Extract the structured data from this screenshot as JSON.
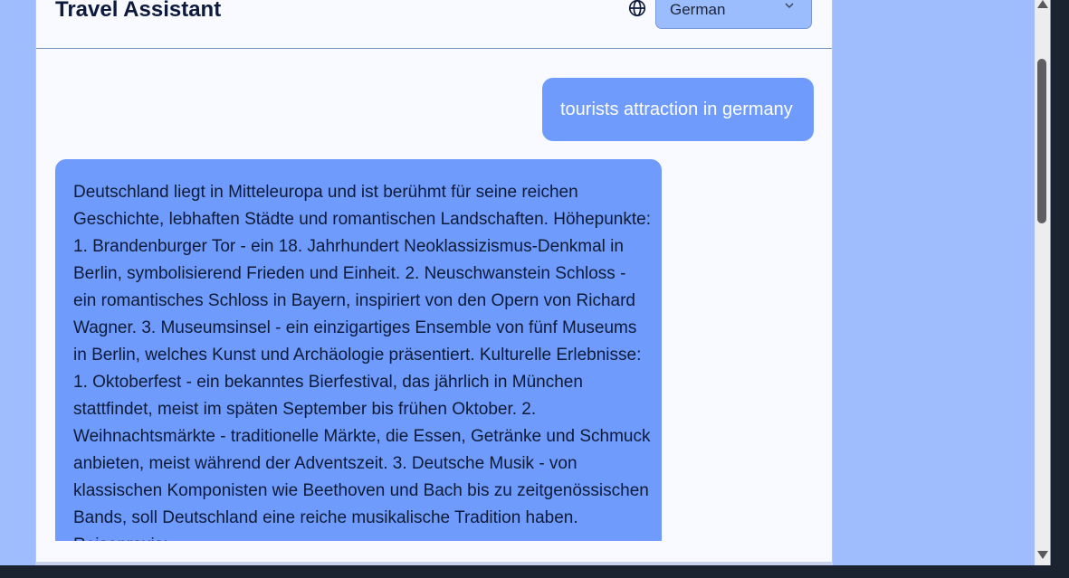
{
  "header": {
    "title": "Travel Assistant",
    "language_icon": "globe-icon",
    "language_selected": "German",
    "dropdown_icon": "chevron-down-icon"
  },
  "messages": [
    {
      "role": "user",
      "text": "tourists attraction in germany"
    },
    {
      "role": "assistant",
      "text": "Deutschland liegt in Mitteleuropa und ist berühmt für seine reichen Geschichte, lebhaften Städte und romantischen Landschaften. Höhepunkte: 1. Brandenburger Tor - ein 18. Jahrhundert Neoklassizismus-Denkmal in Berlin, symbolisierend Frieden und Einheit. 2. Neuschwanstein Schloss - ein romantisches Schloss in Bayern, inspiriert von den Opern von Richard Wagner. 3. Museumsinsel - ein einzigartiges Ensemble von fünf Museums in Berlin, welches Kunst und Archäologie präsentiert. Kulturelle Erlebnisse: 1. Oktoberfest - ein bekanntes Bierfestival, das jährlich in München stattfindet, meist im späten September bis frühen Oktober. 2. Weihnachtsmärkte - traditionelle Märkte, die Essen, Getränke und Schmuck anbieten, meist während der Adventszeit. 3. Deutsche Musik - von klassischen Komponisten wie Beethoven und Bach bis zu zeitgenössischen Bands, soll Deutschland eine reiche musikalische Tradition haben. Reisepraxis:"
    }
  ],
  "colors": {
    "page_background": "#9fbcfd",
    "card_background": "#f8faff",
    "bubble": "#6f9bfd",
    "select_background": "#9cbdfd",
    "title_text": "#0d1a3b"
  }
}
